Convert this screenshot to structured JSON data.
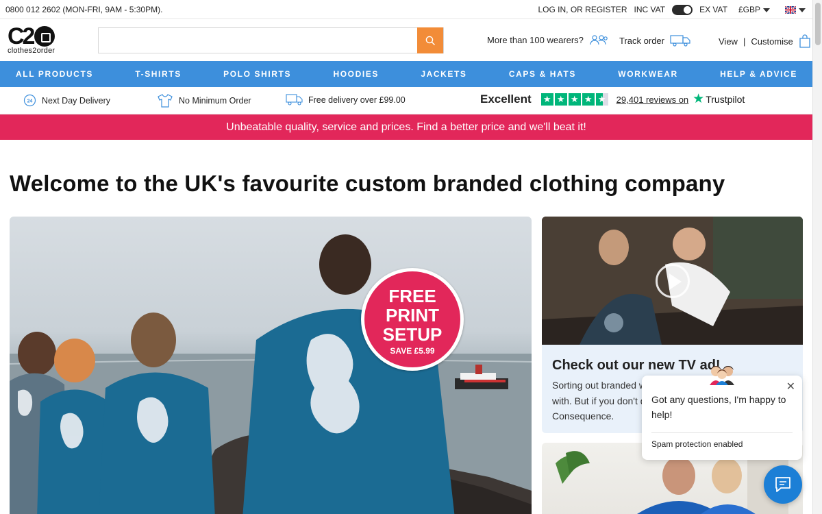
{
  "topbar": {
    "phone": "0800 012 2602 (MON-FRI, 9AM - 5:30PM).",
    "login": "LOG IN, OR REGISTER",
    "inc_vat": "INC VAT",
    "ex_vat": "EX VAT",
    "currency": "£GBP"
  },
  "header": {
    "logo_mark": "C2",
    "logo_sub": "clothes2order",
    "search_placeholder": "",
    "wearers": "More than 100 wearers?",
    "track": "Track order",
    "view": "View",
    "customise": "Customise",
    "divider": "|"
  },
  "nav": [
    "ALL PRODUCTS",
    "T-SHIRTS",
    "POLO SHIRTS",
    "HOODIES",
    "JACKETS",
    "CAPS & HATS",
    "WORKWEAR",
    "HELP & ADVICE"
  ],
  "usp": {
    "next_day": "Next Day Delivery",
    "min_order": "No Minimum Order",
    "free_delivery": "Free delivery over £99.00",
    "rating_word": "Excellent",
    "reviews": "29,401 reviews on",
    "trustpilot": "Trustpilot",
    "stars": 4.5
  },
  "promo": "Unbeatable quality, service and prices. Find a better price and we'll beat it!",
  "page_title": "Welcome to the UK's favourite custom branded clothing company",
  "hero_badge": {
    "line1": "FREE",
    "line2": "PRINT",
    "line3": "SETUP",
    "save": "SAVE £5.99"
  },
  "tv_card": {
    "title": "Check out our new TV ad!",
    "text": "Sorting out branded we with. But if you don't do Consequence."
  },
  "chat": {
    "message": "Got any questions, I'm happy to help!",
    "spam": "Spam protection enabled"
  },
  "colors": {
    "nav": "#3d8fdc",
    "promo": "#e2275a",
    "search_button": "#f28c38",
    "trustpilot": "#00b67a"
  }
}
